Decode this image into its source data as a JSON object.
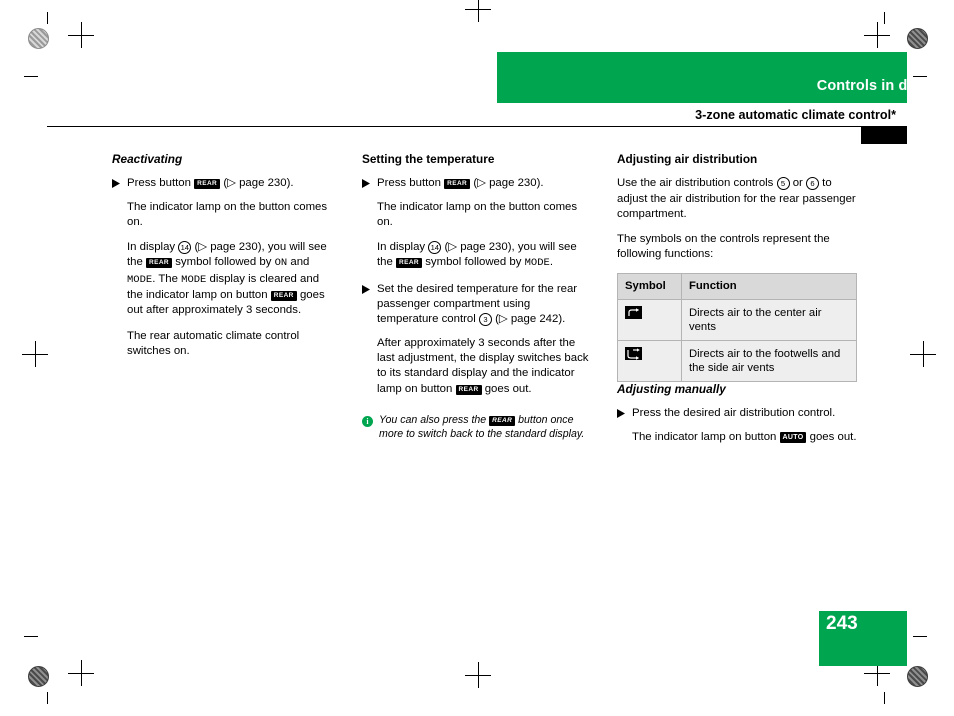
{
  "header": {
    "title": "Controls in detail",
    "subtitle": "3-zone automatic climate control*"
  },
  "page_number": "243",
  "col1": {
    "heading": "Reactivating",
    "bullet1_pre": "Press button ",
    "bullet1_key": "REAR",
    "bullet1_post": " (",
    "bullet1_ref": "page 230).",
    "para1": "The indicator lamp on the button comes on.",
    "para2_a": "In display ",
    "para2_num": "14",
    "para2_b": " (",
    "para2_ref": "page 230), you will see the ",
    "para2_key1": "REAR",
    "para2_c": " symbol followed by ",
    "para2_mono1": "ON",
    "para2_d": " and ",
    "para2_mono2": "MODE",
    "para2_e": ". The ",
    "para2_mono3": "MODE",
    "para2_f": " display is cleared and the indicator lamp on button ",
    "para2_key2": "REAR",
    "para2_g": " goes out after approximately 3 seconds.",
    "para3": "The rear automatic climate control switches on."
  },
  "col2": {
    "heading": "Setting the temperature",
    "bullet1_pre": "Press button ",
    "bullet1_key": "REAR",
    "bullet1_post": " (",
    "bullet1_ref": "page 230).",
    "para1": "The indicator lamp on the button comes on.",
    "para2_a": "In display ",
    "para2_num": "14",
    "para2_b": " (",
    "para2_ref": "page 230), you will see the ",
    "para2_key1": "REAR",
    "para2_c": " symbol followed by ",
    "para2_mono1": "MODE",
    "para2_d": ".",
    "bullet2_a": "Set the desired temperature for the rear passenger compartment using temperature control ",
    "bullet2_num": "3",
    "bullet2_b": " (",
    "bullet2_ref": "page 242).",
    "para3_a": "After approximately 3 seconds after the last adjustment, the display switches back to its standard display and the indicator lamp on button ",
    "para3_key": "REAR",
    "para3_b": " goes out.",
    "note_a": "You can also press the ",
    "note_key": "REAR",
    "note_b": " button once more to switch back to the standard display."
  },
  "col3": {
    "heading": "Adjusting air distribution",
    "para1_a": "Use the air distribution controls ",
    "para1_num1": "5",
    "para1_b": " or ",
    "para1_num2": "6",
    "para1_c": " to adjust the air distribution for the rear passenger compartment.",
    "para2": "The symbols on the controls represent the following functions:",
    "table": {
      "headers": [
        "Symbol",
        "Function"
      ],
      "rows": [
        {
          "symbol": "center-vents-icon",
          "function": "Directs air to the center air vents"
        },
        {
          "symbol": "footwell-side-vents-icon",
          "function": "Directs air to the footwells and the side air vents"
        }
      ]
    },
    "heading2": "Adjusting manually",
    "bullet1": "Press the desired air distribution control.",
    "para3_a": "The indicator lamp on button ",
    "para3_key": "AUTO",
    "para3_b": " goes out."
  },
  "colors": {
    "accent": "#00a550",
    "table_header": "#d9d9d9",
    "table_cell": "#eeeeee"
  }
}
